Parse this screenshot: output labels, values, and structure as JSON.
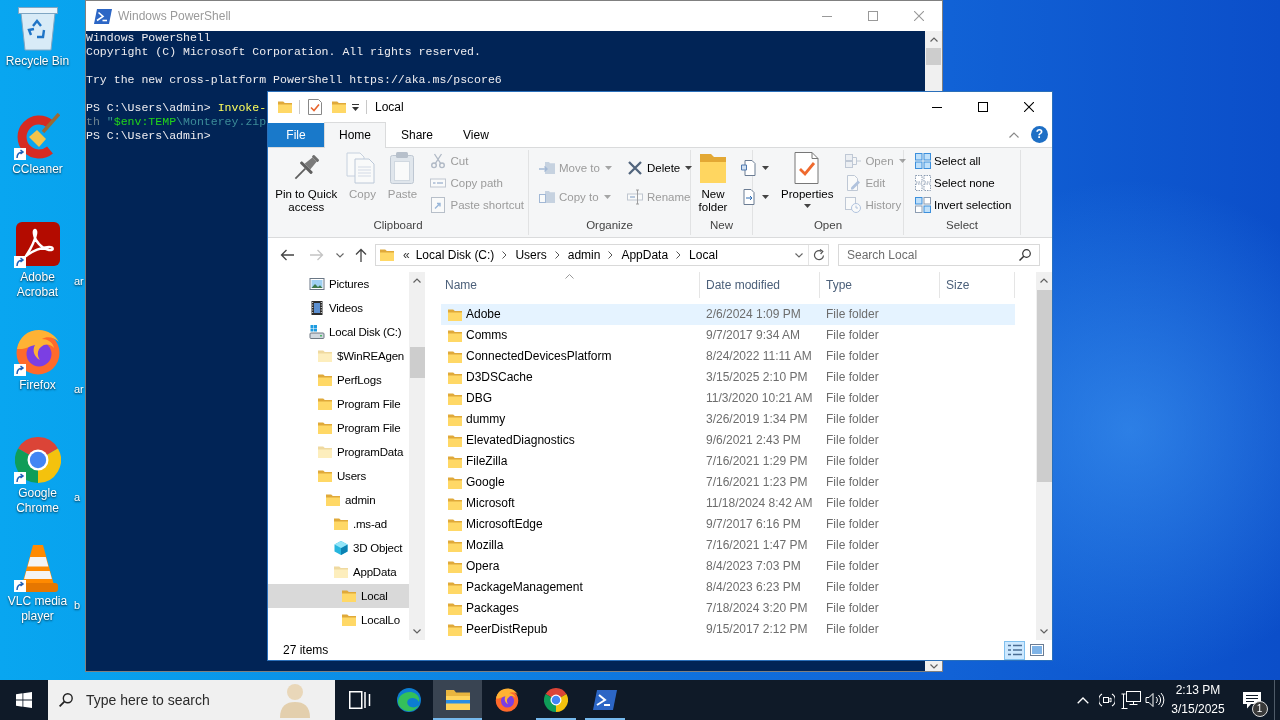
{
  "desktop": {
    "icons": [
      {
        "label": "Recycle Bin",
        "kind": "recycle",
        "shortcut": false
      },
      {
        "label": "CCleaner",
        "kind": "ccleaner",
        "shortcut": true
      },
      {
        "label": "Adobe Acrobat",
        "kind": "acrobat",
        "shortcut": true
      },
      {
        "label": "Firefox",
        "kind": "firefox",
        "shortcut": true
      },
      {
        "label": "Google Chrome",
        "kind": "chrome",
        "shortcut": true
      },
      {
        "label": "VLC media player",
        "kind": "vlc",
        "shortcut": true
      }
    ],
    "covered_icon_labels": [
      "ar",
      "ar",
      "a",
      "b"
    ]
  },
  "powershell": {
    "title": "Windows PowerShell",
    "active": false,
    "blocks": [
      [
        [
          {
            "text": "Windows PowerShell",
            "kind": "output"
          }
        ],
        [
          {
            "text": "Copyright (C) Microsoft Corporation. All rights reserved.",
            "kind": "output"
          }
        ]
      ],
      [
        [
          {
            "text": "Try the new cross-platform PowerShell https://aka.ms/pscore6",
            "kind": "output"
          }
        ]
      ],
      [
        [
          {
            "text": "PS C:\\Users\\admin> ",
            "kind": "output"
          },
          {
            "text": "Invoke-",
            "kind": "command"
          }
        ],
        [
          {
            "text": "th",
            "kind": "parameter"
          },
          {
            "text": " \"",
            "kind": "string"
          },
          {
            "text": "$env:TEMP",
            "kind": "variable"
          },
          {
            "text": "\\Monterey.zip",
            "kind": "string"
          }
        ],
        [
          {
            "text": "PS C:\\Users\\admin>",
            "kind": "output"
          }
        ]
      ]
    ]
  },
  "explorer": {
    "title": "Local",
    "active": true,
    "help": "?",
    "tabs": [
      {
        "label": "File",
        "kind": "backstage",
        "selected": false
      },
      {
        "label": "Home",
        "kind": "tab",
        "selected": true
      },
      {
        "label": "Share",
        "kind": "tab",
        "selected": false
      },
      {
        "label": "View",
        "kind": "tab",
        "selected": false
      }
    ],
    "ribbon": [
      {
        "label": "Clipboard",
        "columns": [
          [
            {
              "kind": "large",
              "label": "Pin to Quick access",
              "disabled": false,
              "dropdown": false
            }
          ],
          [
            {
              "kind": "large",
              "label": "Copy",
              "disabled": true,
              "dropdown": false
            }
          ],
          [
            {
              "kind": "large",
              "label": "Paste",
              "disabled": true,
              "dropdown": false
            }
          ],
          [
            {
              "kind": "small",
              "label": "Cut",
              "disabled": true,
              "dropdown": false
            },
            {
              "kind": "small",
              "label": "Copy path",
              "disabled": true,
              "dropdown": false
            },
            {
              "kind": "small",
              "label": "Paste shortcut",
              "disabled": true,
              "dropdown": false
            }
          ]
        ]
      },
      {
        "label": "Organize",
        "columns": [
          [
            {
              "kind": "small",
              "label": "Move to",
              "disabled": true,
              "dropdown": true
            },
            {
              "kind": "small",
              "label": "Copy to",
              "disabled": true,
              "dropdown": true
            }
          ],
          [
            {
              "kind": "small",
              "label": "Delete",
              "disabled": false,
              "dropdown": true
            },
            {
              "kind": "small",
              "label": "Rename",
              "disabled": true,
              "dropdown": false
            }
          ]
        ]
      },
      {
        "label": "New",
        "columns": [
          [
            {
              "kind": "large",
              "label": "New folder",
              "disabled": false,
              "dropdown": false
            }
          ],
          [
            {
              "kind": "icon",
              "disabled": false,
              "dropdown": true
            },
            {
              "kind": "icon",
              "disabled": false,
              "dropdown": true
            }
          ]
        ]
      },
      {
        "label": "Open",
        "columns": [
          [
            {
              "kind": "large",
              "label": "Properties",
              "disabled": false,
              "dropdown": true
            }
          ],
          [
            {
              "kind": "small",
              "label": "Open",
              "disabled": true,
              "dropdown": true
            },
            {
              "kind": "small",
              "label": "Edit",
              "disabled": true,
              "dropdown": false
            },
            {
              "kind": "small",
              "label": "History",
              "disabled": true,
              "dropdown": false
            }
          ]
        ]
      },
      {
        "label": "Select",
        "columns": [
          [
            {
              "kind": "small",
              "label": "Select all",
              "disabled": false,
              "dropdown": false
            },
            {
              "kind": "small",
              "label": "Select none",
              "disabled": false,
              "dropdown": false
            },
            {
              "kind": "small",
              "label": "Invert selection",
              "disabled": false,
              "dropdown": false
            }
          ]
        ]
      }
    ],
    "address": {
      "back_disabled": false,
      "forward_disabled": true,
      "overflow": "«",
      "crumbs": [
        "Local Disk (C:)",
        "Users",
        "admin",
        "AppData",
        "Local"
      ]
    },
    "search_placeholder": "Search Local",
    "tree": [
      {
        "label": "Pictures",
        "kind": "pictures",
        "selected": false
      },
      {
        "label": "Videos",
        "kind": "videos",
        "selected": false
      },
      {
        "label": "Local Disk (C:)",
        "kind": "drive",
        "selected": false,
        "children": [
          {
            "label": "$WinREAgen",
            "kind": "hidden",
            "selected": false
          },
          {
            "label": "PerfLogs",
            "kind": "folder",
            "selected": false
          },
          {
            "label": "Program File",
            "kind": "folder",
            "selected": false
          },
          {
            "label": "Program File",
            "kind": "folder",
            "selected": false
          },
          {
            "label": "ProgramData",
            "kind": "hidden",
            "selected": false
          },
          {
            "label": "Users",
            "kind": "folder",
            "selected": false,
            "children": [
              {
                "label": "admin",
                "kind": "folder",
                "selected": false,
                "children": [
                  {
                    "label": ".ms-ad",
                    "kind": "folder",
                    "selected": false
                  },
                  {
                    "label": "3D Object",
                    "kind": "objects",
                    "selected": false
                  },
                  {
                    "label": "AppData",
                    "kind": "hidden",
                    "selected": false,
                    "children": [
                      {
                        "label": "Local",
                        "kind": "folder",
                        "selected": true
                      },
                      {
                        "label": "LocalLo",
                        "kind": "folder",
                        "selected": false
                      }
                    ]
                  }
                ]
              }
            ]
          }
        ]
      }
    ],
    "columns": [
      {
        "label": "Name",
        "sorted": true
      },
      {
        "label": "Date modified",
        "sorted": false
      },
      {
        "label": "Type",
        "sorted": false
      },
      {
        "label": "Size",
        "sorted": false
      }
    ],
    "files": [
      {
        "name": "Adobe",
        "modified": "2/6/2024 1:09 PM",
        "type": "File folder",
        "hovered": true
      },
      {
        "name": "Comms",
        "modified": "9/7/2017 9:34 AM",
        "type": "File folder",
        "hovered": false
      },
      {
        "name": "ConnectedDevicesPlatform",
        "modified": "8/24/2022 11:11 AM",
        "type": "File folder",
        "hovered": false
      },
      {
        "name": "D3DSCache",
        "modified": "3/15/2025 2:10 PM",
        "type": "File folder",
        "hovered": false
      },
      {
        "name": "DBG",
        "modified": "11/3/2020 10:21 AM",
        "type": "File folder",
        "hovered": false
      },
      {
        "name": "dummy",
        "modified": "3/26/2019 1:34 PM",
        "type": "File folder",
        "hovered": false
      },
      {
        "name": "ElevatedDiagnostics",
        "modified": "9/6/2021 2:43 PM",
        "type": "File folder",
        "hovered": false
      },
      {
        "name": "FileZilla",
        "modified": "7/16/2021 1:29 PM",
        "type": "File folder",
        "hovered": false
      },
      {
        "name": "Google",
        "modified": "7/16/2021 1:23 PM",
        "type": "File folder",
        "hovered": false
      },
      {
        "name": "Microsoft",
        "modified": "11/18/2024 8:42 AM",
        "type": "File folder",
        "hovered": false
      },
      {
        "name": "MicrosoftEdge",
        "modified": "9/7/2017 6:16 PM",
        "type": "File folder",
        "hovered": false
      },
      {
        "name": "Mozilla",
        "modified": "7/16/2021 1:47 PM",
        "type": "File folder",
        "hovered": false
      },
      {
        "name": "Opera",
        "modified": "8/4/2023 7:03 PM",
        "type": "File folder",
        "hovered": false
      },
      {
        "name": "PackageManagement",
        "modified": "8/4/2023 6:23 PM",
        "type": "File folder",
        "hovered": false
      },
      {
        "name": "Packages",
        "modified": "7/18/2024 3:20 PM",
        "type": "File folder",
        "hovered": false
      },
      {
        "name": "PeerDistRepub",
        "modified": "9/15/2017 2:12 PM",
        "type": "File folder",
        "hovered": false
      }
    ],
    "status": "27 items",
    "views": [
      {
        "kind": "details",
        "selected": true
      },
      {
        "kind": "icons",
        "selected": false
      }
    ]
  },
  "taskbar": {
    "search_placeholder": "Type here to search",
    "apps": [
      {
        "kind": "taskview",
        "running": false,
        "active": false
      },
      {
        "kind": "edge",
        "running": false,
        "active": false
      },
      {
        "kind": "explorer",
        "running": true,
        "active": true
      },
      {
        "kind": "firefox",
        "running": false,
        "active": false
      },
      {
        "kind": "chrome",
        "running": true,
        "active": false
      },
      {
        "kind": "powershell",
        "running": true,
        "active": false
      }
    ],
    "time": "2:13 PM",
    "date": "3/15/2025",
    "notifications": "1"
  }
}
